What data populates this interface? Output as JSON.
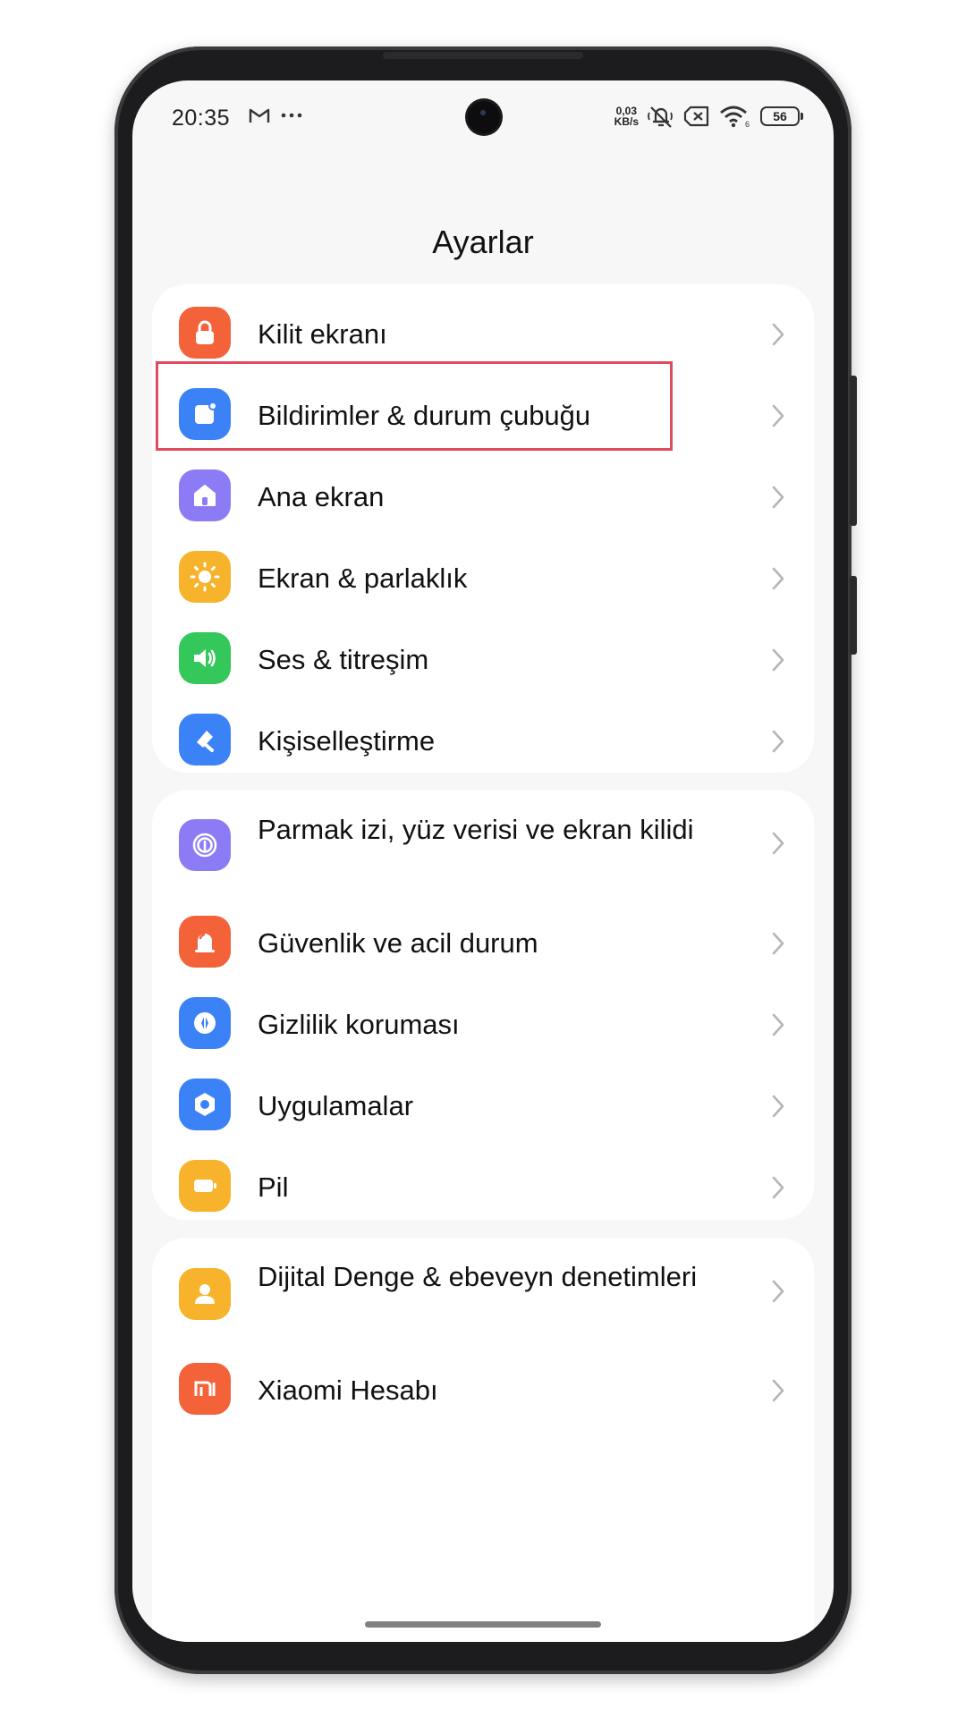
{
  "status_bar": {
    "time": "20:35",
    "net_speed_value": "0,03",
    "net_speed_unit": "KB/s",
    "wifi_sub": "6",
    "battery": "56"
  },
  "page": {
    "title": "Ayarlar"
  },
  "groups": [
    {
      "items": [
        {
          "label": "Kilit ekranı",
          "icon": "lock-icon",
          "color": "#f4623a"
        },
        {
          "label": "Bildirimler & durum çubuğu",
          "icon": "notification-icon",
          "color": "#3b82f6"
        },
        {
          "label": "Ana ekran",
          "icon": "home-icon",
          "color": "#8b7cf6"
        },
        {
          "label": "Ekran & parlaklık",
          "icon": "sun-icon",
          "color": "#f7b32b"
        },
        {
          "label": "Ses & titreşim",
          "icon": "speaker-icon",
          "color": "#34c759"
        },
        {
          "label": "Kişiselleştirme",
          "icon": "brush-icon",
          "color": "#3b82f6"
        }
      ]
    },
    {
      "items": [
        {
          "label": "Parmak izi, yüz verisi ve ekran kilidi",
          "icon": "fingerprint-icon",
          "color": "#8b7cf6"
        },
        {
          "label": "Güvenlik ve acil durum",
          "icon": "emergency-icon",
          "color": "#f4623a"
        },
        {
          "label": "Gizlilik koruması",
          "icon": "privacy-icon",
          "color": "#3b82f6"
        },
        {
          "label": "Uygulamalar",
          "icon": "apps-icon",
          "color": "#3b82f6"
        },
        {
          "label": "Pil",
          "icon": "battery-icon",
          "color": "#f7b32b"
        }
      ]
    },
    {
      "items": [
        {
          "label": "Dijital Denge & ebeveyn denetimleri",
          "icon": "wellbeing-icon",
          "color": "#f7b32b"
        },
        {
          "label": "Xiaomi Hesabı",
          "icon": "mi-account-icon",
          "color": "#f4623a"
        }
      ]
    }
  ],
  "accent_colors": {
    "highlight_border": "#e04a5c"
  }
}
